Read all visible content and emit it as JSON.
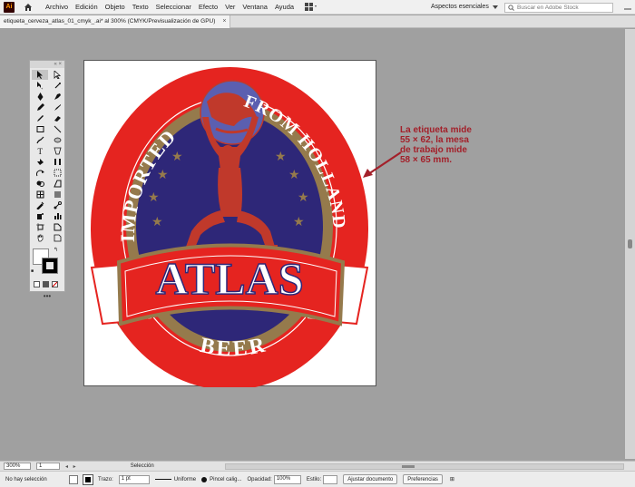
{
  "app": {
    "logo": "Ai",
    "logo_color": "#ff9a00"
  },
  "menu": [
    "Archivo",
    "Edición",
    "Objeto",
    "Texto",
    "Seleccionar",
    "Efecto",
    "Ver",
    "Ventana",
    "Ayuda"
  ],
  "workspace": {
    "label": "Aspectos esenciales",
    "search_placeholder": "Buscar en Adobe Stock"
  },
  "document_tab": {
    "title": "etiqueta_cerveza_atlas_01_cmyk_.ai* al 300% (CMYK/Previsualización de GPU)",
    "close": "×"
  },
  "toolbar": {
    "head": "« ×",
    "more": "•••"
  },
  "label": {
    "top_left": "IMPORTED",
    "top_right": "FROM HOLLAND",
    "brand": "ATLAS",
    "bottom": "BEER",
    "colors": {
      "red": "#e52420",
      "gold": "#957a4c",
      "blue": "#2e2778",
      "white": "#ffffff",
      "brand_red": "#c11e28",
      "figure": "#c0392b"
    }
  },
  "annotation": {
    "lines": [
      "La etiqueta mide",
      "55 × 62, la mesa",
      "de trabajo mide",
      "58 × 65 mm."
    ],
    "color": "#a3202a"
  },
  "status": {
    "zoom": "300%",
    "page": "1",
    "nav": "◂ ▸",
    "mode": "Selección"
  },
  "control": {
    "selection": "No hay selección",
    "stroke_label": "Trazo:",
    "stroke_value": "1 pt",
    "profile": "Uniforme",
    "brush": "Pincel calig...",
    "opacity_label": "Opacidad:",
    "opacity_value": "100%",
    "style_label": "Estilo:",
    "adjust": "Ajustar documento",
    "prefs": "Preferencias"
  }
}
